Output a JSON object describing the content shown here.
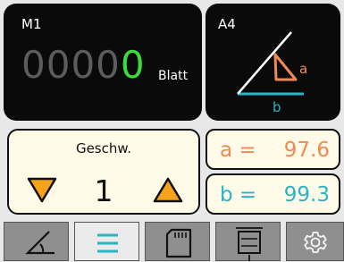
{
  "counter": {
    "mode_label": "M1",
    "zeros": "0000",
    "last_digit": "0",
    "unit": "Blatt"
  },
  "angle_panel": {
    "format_label": "A4",
    "label_a": "a",
    "label_b": "b"
  },
  "speed": {
    "title": "Geschw.",
    "value": "1"
  },
  "measurements": {
    "a": {
      "label": "a =",
      "value": "97.6"
    },
    "b": {
      "label": "b =",
      "value": "99.3"
    }
  },
  "tabs": [
    {
      "icon": "angle-icon",
      "active": false
    },
    {
      "icon": "menu-icon",
      "active": true
    },
    {
      "icon": "sd-card-icon",
      "active": false
    },
    {
      "icon": "frame-resize-icon",
      "active": false
    },
    {
      "icon": "gear-icon",
      "active": false
    }
  ],
  "colors": {
    "accent_orange": "#f08a54",
    "accent_cyan": "#2bb3c7",
    "counter_green": "#3ddc3d",
    "panel_cream": "#fffbe8"
  }
}
